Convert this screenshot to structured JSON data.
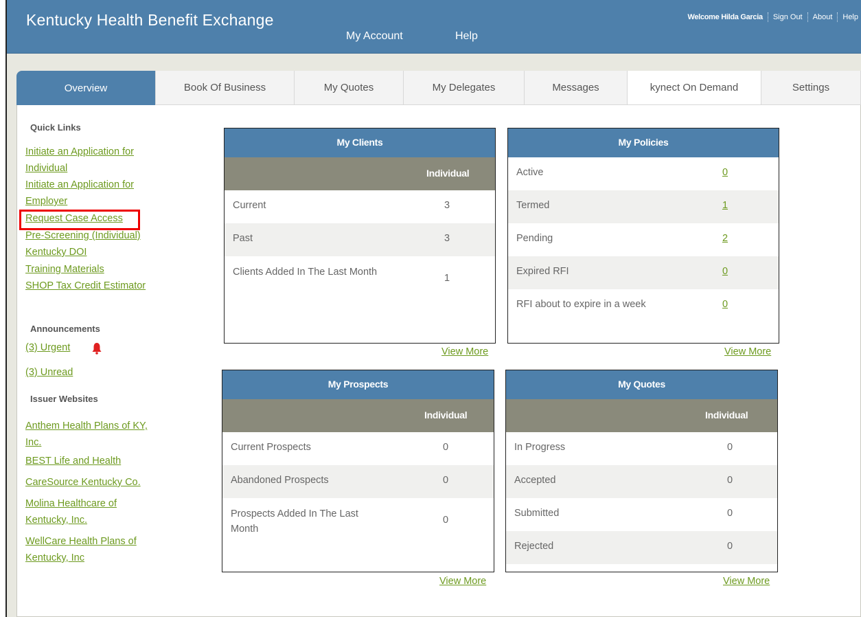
{
  "header": {
    "title": "Kentucky Health Benefit Exchange",
    "nav": [
      "My Account",
      "Help"
    ],
    "welcome": "Welcome Hilda Garcia",
    "util_links": [
      "Sign Out",
      "About",
      "Help"
    ]
  },
  "tabs": [
    "Overview",
    "Book Of Business",
    "My Quotes",
    "My Delegates",
    "Messages",
    "kynect On Demand",
    "Settings"
  ],
  "sidebar": {
    "quick_links_heading": "Quick Links",
    "quick_links": [
      "Initiate an Application for",
      "Individual",
      "Initiate an Application for",
      "Employer",
      "Request Case Access",
      "Pre-Screening (Individual)",
      "Kentucky DOI",
      "Training Materials",
      "SHOP Tax Credit Estimator"
    ],
    "announcements_heading": "Announcements",
    "announcements": [
      "(3) Urgent",
      "(3) Unread"
    ],
    "issuer_heading": "Issuer Websites",
    "issuers": [
      "Anthem Health Plans of KY,",
      "Inc.",
      "BEST Life and Health",
      "CareSource Kentucky Co.",
      "Molina Healthcare of",
      "Kentucky, Inc.",
      "WellCare Health Plans of",
      "Kentucky, Inc"
    ]
  },
  "widgets": {
    "view_more": "View More",
    "my_clients": {
      "title": "My Clients",
      "column": "Individual",
      "rows": [
        {
          "label": "Current",
          "value": "3"
        },
        {
          "label": "Past",
          "value": "3"
        },
        {
          "label": "Clients Added In The Last Month",
          "value": "1"
        }
      ]
    },
    "my_policies": {
      "title": "My Policies",
      "rows": [
        {
          "label": "Active",
          "value": "0"
        },
        {
          "label": "Termed",
          "value": "1"
        },
        {
          "label": "Pending",
          "value": "2"
        },
        {
          "label": "Expired RFI",
          "value": "0"
        },
        {
          "label": "RFI about to expire in a week",
          "value": "0"
        }
      ]
    },
    "my_prospects": {
      "title": "My Prospects",
      "column": "Individual",
      "rows": [
        {
          "label": "Current Prospects",
          "value": "0"
        },
        {
          "label": "Abandoned Prospects",
          "value": "0"
        },
        {
          "label": "Prospects Added In The Last Month",
          "value": "0"
        }
      ]
    },
    "my_quotes": {
      "title": "My Quotes",
      "column": "Individual",
      "rows": [
        {
          "label": "In Progress",
          "value": "0"
        },
        {
          "label": "Accepted",
          "value": "0"
        },
        {
          "label": "Submitted",
          "value": "0"
        },
        {
          "label": "Rejected",
          "value": "0"
        }
      ]
    }
  },
  "colors": {
    "brand_blue": "#4e80ab",
    "link_green": "#6d9a1f",
    "subheader_gray": "#8a8a7b",
    "highlight_red": "#e00000"
  },
  "icons": {
    "urgent": "bell-icon"
  }
}
